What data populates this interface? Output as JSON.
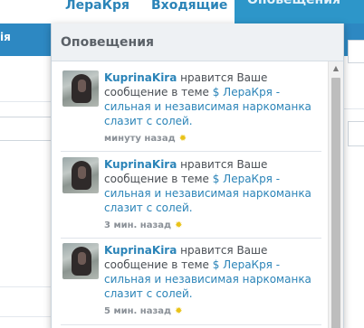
{
  "nav": {
    "tab1": "ЛераКря",
    "tab2": "Входящие",
    "tab3": "Оповещения"
  },
  "background": {
    "bar_label": "ія"
  },
  "popup": {
    "title": "Оповещения",
    "alerts": [
      {
        "user": "KuprinaKira",
        "action": " нравится Ваше сообщение в теме ",
        "link": "$ ЛераКря - сильная и независимая наркоманка слазит с солей.",
        "time": "минуту назад"
      },
      {
        "user": "KuprinaKira",
        "action": " нравится Ваше сообщение в теме ",
        "link": "$ ЛераКря - сильная и независимая наркоманка слазит с солей.",
        "time": "3 мин. назад"
      },
      {
        "user": "KuprinaKira",
        "action": " нравится Ваше сообщение в теме ",
        "link": "$ ЛераКря - сильная и независимая наркоманка слазит с солей.",
        "time": "5 мин. назад"
      }
    ]
  },
  "icons": {
    "like": "sun-like-icon",
    "scroll_up": "scroll-up-arrow-icon"
  },
  "colors": {
    "accent": "#2b84b8",
    "active_tab": "#2d96c9",
    "like": "#e9c217"
  }
}
